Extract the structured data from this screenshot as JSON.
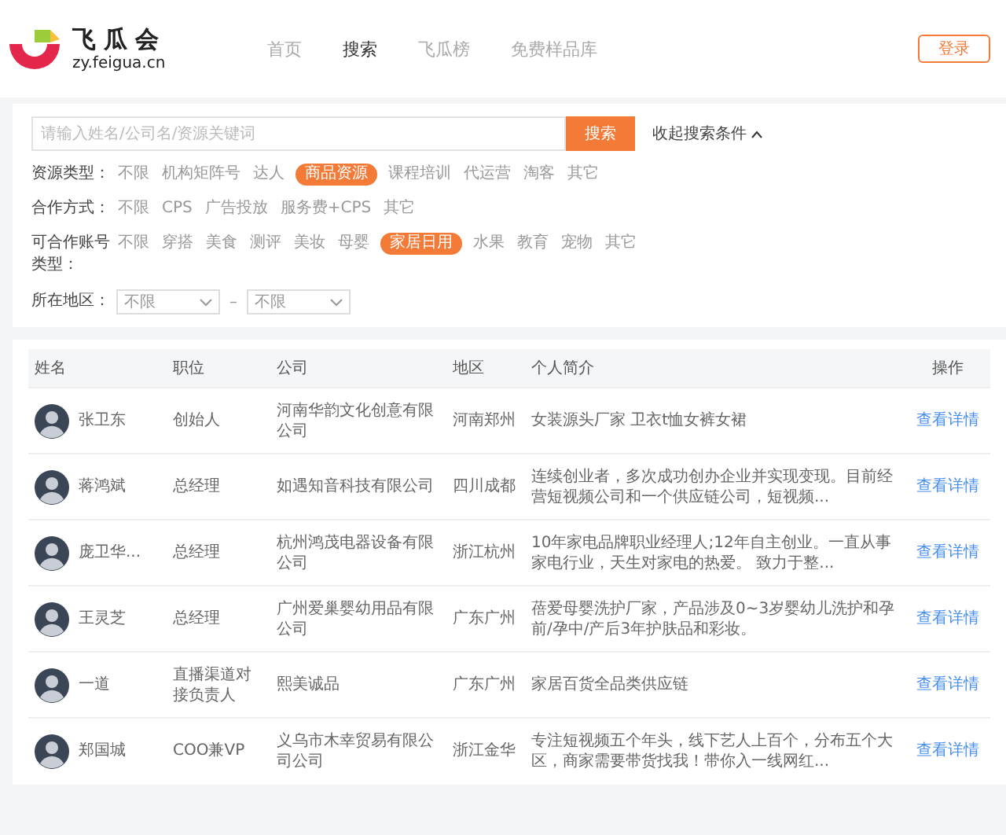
{
  "header": {
    "logo": {
      "name": "飞瓜会",
      "domain": "zy.feigua.cn"
    },
    "nav": [
      {
        "label": "首页",
        "selected": false
      },
      {
        "label": "搜索",
        "selected": true
      },
      {
        "label": "飞瓜榜",
        "selected": false
      },
      {
        "label": "免费样品库",
        "selected": false
      }
    ],
    "login": "登录"
  },
  "search": {
    "placeholder": "请输入姓名/公司名/资源关键词",
    "button": "搜索",
    "collapse": "收起搜索条件"
  },
  "filters": [
    {
      "label": "资源类型：",
      "options": [
        {
          "label": "不限",
          "selected": false
        },
        {
          "label": "机构矩阵号",
          "selected": false
        },
        {
          "label": "达人",
          "selected": false
        },
        {
          "label": "商品资源",
          "selected": true
        },
        {
          "label": "课程培训",
          "selected": false
        },
        {
          "label": "代运营",
          "selected": false
        },
        {
          "label": "淘客",
          "selected": false
        },
        {
          "label": "其它",
          "selected": false
        }
      ]
    },
    {
      "label": "合作方式：",
      "options": [
        {
          "label": "不限",
          "selected": false
        },
        {
          "label": "CPS",
          "selected": false
        },
        {
          "label": "广告投放",
          "selected": false
        },
        {
          "label": "服务费+CPS",
          "selected": false
        },
        {
          "label": "其它",
          "selected": false
        }
      ]
    },
    {
      "label": "可合作账号类型：",
      "options": [
        {
          "label": "不限",
          "selected": false
        },
        {
          "label": "穿搭",
          "selected": false
        },
        {
          "label": "美食",
          "selected": false
        },
        {
          "label": "测评",
          "selected": false
        },
        {
          "label": "美妆",
          "selected": false
        },
        {
          "label": "母婴",
          "selected": false
        },
        {
          "label": "家居日用",
          "selected": true
        },
        {
          "label": "水果",
          "selected": false
        },
        {
          "label": "教育",
          "selected": false
        },
        {
          "label": "宠物",
          "selected": false
        },
        {
          "label": "其它",
          "selected": false
        }
      ]
    }
  ],
  "region": {
    "label": "所在地区：",
    "from": "不限",
    "separator": "–",
    "to": "不限"
  },
  "table": {
    "columns": [
      "姓名",
      "职位",
      "公司",
      "地区",
      "个人简介",
      "操作"
    ],
    "rows": [
      {
        "name": "张卫东",
        "position": "创始人",
        "company": "河南华韵文化创意有限公司",
        "region": "河南郑州",
        "bio": "女装源头厂家 卫衣t恤女裤女裙",
        "action": "查看详情"
      },
      {
        "name": "蒋鸿斌",
        "position": "总经理",
        "company": "如遇知音科技有限公司",
        "region": "四川成都",
        "bio": "连续创业者，多次成功创办企业并实现变现。目前经营短视频公司和一个供应链公司，短视频...",
        "action": "查看详情"
      },
      {
        "name": "庞卫华...",
        "position": "总经理",
        "company": "杭州鸿茂电器设备有限公司",
        "region": "浙江杭州",
        "bio": "10年家电品牌职业经理人;12年自主创业。一直从事家电行业，天生对家电的热爱。 致力于整...",
        "action": "查看详情"
      },
      {
        "name": "王灵芝",
        "position": "总经理",
        "company": "广州爱巢婴幼用品有限公司",
        "region": "广东广州",
        "bio": "蓓爱母婴洗护厂家，产品涉及0~3岁婴幼儿洗护和孕前/孕中/产后3年护肤品和彩妆。",
        "action": "查看详情"
      },
      {
        "name": "一道",
        "position": "直播渠道对接负责人",
        "company": "熙美诚品",
        "region": "广东广州",
        "bio": "家居百货全品类供应链",
        "action": "查看详情"
      },
      {
        "name": "郑国城",
        "position": "COO兼VP",
        "company": "义乌市木幸贸易有限公司公司",
        "region": "浙江金华",
        "bio": "专注短视频五个年头，线下艺人上百个，分布五个大区，商家需要带货找我！带你入一线网红...",
        "action": "查看详情"
      }
    ]
  }
}
